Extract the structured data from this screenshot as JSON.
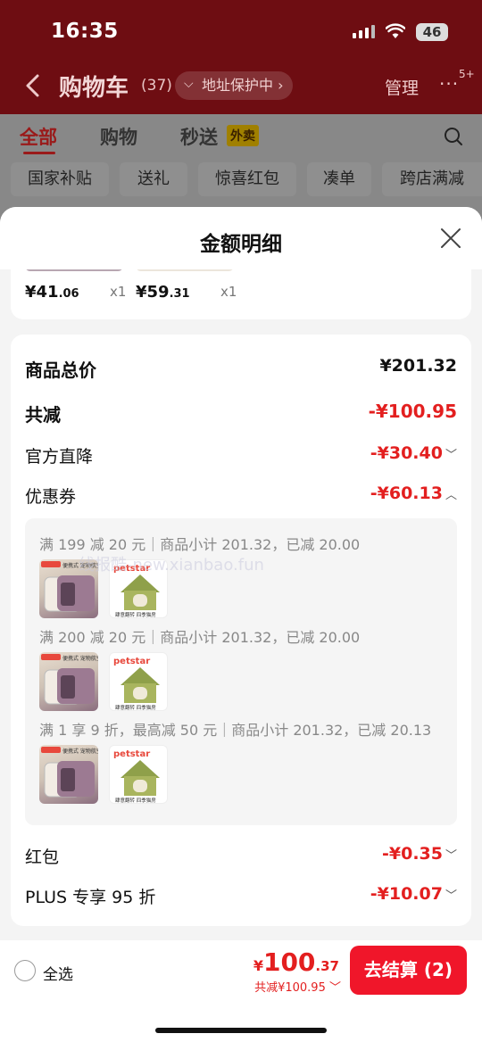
{
  "status": {
    "time": "16:35",
    "battery": "46"
  },
  "nav": {
    "title": "购物车",
    "count": "(37)",
    "address": "地址保护中 ›",
    "manage": "管理",
    "more_badge": "5+"
  },
  "tabs": [
    {
      "label": "全部"
    },
    {
      "label": "购物"
    },
    {
      "label": "秒送",
      "tag": "外卖"
    }
  ],
  "chips": [
    "国家补贴",
    "送礼",
    "惊喜红包",
    "凑单",
    "跨店满减"
  ],
  "sheet": {
    "title": "金额明细",
    "items": [
      {
        "price_int": "¥41",
        "price_dec": ".06",
        "qty": "x1"
      },
      {
        "price_int": "¥59",
        "price_dec": ".31",
        "qty": "x1"
      }
    ],
    "total_label": "商品总价",
    "total_value": "¥201.32",
    "discount_label": "共减",
    "discount_value": "-¥100.95",
    "official_label": "官方直降",
    "official_value": "-¥30.40",
    "coupon_label": "优惠券",
    "coupon_value": "-¥60.13",
    "coupons": [
      "满 199 减 20 元｜商品小计 201.32，已减 20.00",
      "满 200 减 20 元｜商品小计 201.32，已减 20.00",
      "满 1 享 9 折，最高减 50 元｜商品小计 201.32，已减 20.13"
    ],
    "watermark": "线报酷-new.xianbao.fun",
    "product_texts": {
      "carrier": "便携式 宠物航空箱",
      "house_brand": "petstar",
      "house_caption": "肆意翻转 四季猫房"
    },
    "redpacket_label": "红包",
    "redpacket_value": "-¥0.35",
    "plus_label": "PLUS 专享 95 折",
    "plus_value": "-¥10.07"
  },
  "bottom": {
    "select_all": "全选",
    "currency": "¥",
    "total_int": "100",
    "total_dec": ".37",
    "saved": "共减¥100.95",
    "checkout": "去结算 (2)"
  }
}
